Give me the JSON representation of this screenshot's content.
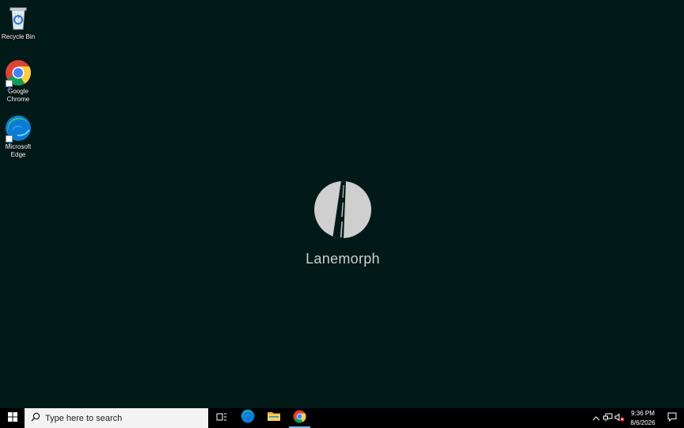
{
  "desktop": {
    "icons": [
      {
        "label": "Recycle Bin",
        "icon": "recycle-bin-icon"
      },
      {
        "label": "Google Chrome",
        "icon": "chrome-icon"
      },
      {
        "label": "Microsoft Edge",
        "icon": "edge-icon"
      }
    ],
    "brand": {
      "name": "Lanemorph",
      "logo": "road-logo"
    }
  },
  "taskbar": {
    "start_icon": "windows-logo-icon",
    "search": {
      "placeholder": "Type here to search",
      "icon": "search-icon"
    },
    "apps": [
      {
        "name": "Task View",
        "icon": "task-view-icon"
      },
      {
        "name": "Microsoft Edge",
        "icon": "edge-icon"
      },
      {
        "name": "File Explorer",
        "icon": "folder-icon"
      },
      {
        "name": "Google Chrome",
        "icon": "chrome-icon",
        "active": true
      }
    ],
    "tray": {
      "icons": [
        "chevron-up-icon",
        "network-icon",
        "volume-muted-icon"
      ],
      "time": "9:36 PM",
      "date": "8/6/2026",
      "notification_icon": "notification-icon"
    }
  },
  "colors": {
    "desktop_bg": "#021a17",
    "taskbar_bg": "#000000",
    "accent": "#76b9ed"
  }
}
